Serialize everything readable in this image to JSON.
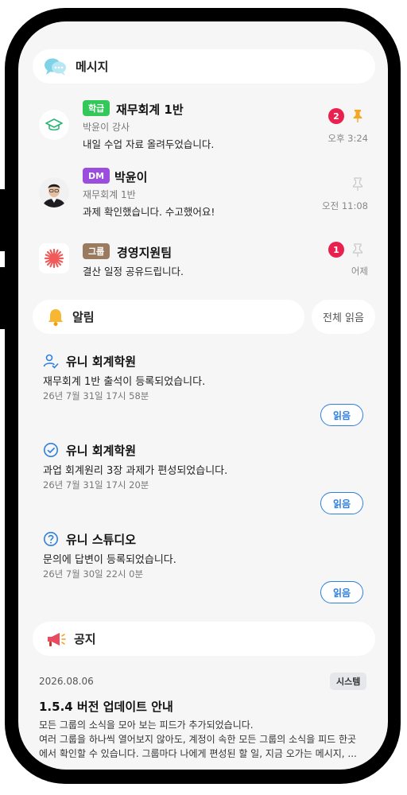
{
  "messages_section": {
    "title": "메시지",
    "icon": "chat-bubbles-icon"
  },
  "messages": [
    {
      "tag": "학급",
      "tag_color": "#34c759",
      "title": "재무회계 1반",
      "subtitle": "박윤이 강사",
      "text": "내일 수업 자료 올려두었습니다.",
      "badge": "2",
      "pinned": true,
      "time": "오후 3:24",
      "avatar": "graduation-cap-icon"
    },
    {
      "tag": "DM",
      "tag_color": "#9b4dde",
      "title": "박윤이",
      "subtitle": "재무회계 1반",
      "text": "과제 확인했습니다. 수고했어요!",
      "badge": "",
      "pinned": false,
      "time": "오전 11:08",
      "avatar": "person-photo"
    },
    {
      "tag": "그룹",
      "tag_color": "#9a7b5f",
      "title": "경영지원팀",
      "subtitle": "",
      "text": "결산 일정 공유드립니다.",
      "badge": "1",
      "pinned": false,
      "time": "어제",
      "avatar": "red-flower-logo"
    }
  ],
  "alerts_section": {
    "title": "알림",
    "icon": "bell-icon",
    "read_all": "전체 읽음"
  },
  "alerts": [
    {
      "icon": "person-check-icon",
      "title": "유니 회계학원",
      "text": "재무회계 1반 출석이 등록되었습니다.",
      "date": "26년 7월 31일 17시 58분",
      "button": "읽음"
    },
    {
      "icon": "circle-check-icon",
      "title": "유니 회계학원",
      "text": "과업 회계원리 3장 과제가 편성되었습니다.",
      "date": "26년 7월 31일 17시 20분",
      "button": "읽음"
    },
    {
      "icon": "question-circle-icon",
      "title": "유니 스튜디오",
      "text": "문의에 답변이 등록되었습니다.",
      "date": "26년 7월 30일 22시 0분",
      "button": "읽음"
    }
  ],
  "notice_section": {
    "title": "공지",
    "icon": "megaphone-icon"
  },
  "notice": {
    "date": "2026.08.06",
    "chip": "시스템",
    "title": "1.5.4 버전 업데이트 안내",
    "body": [
      "모든 그룹의 소식을 모아 보는 피드가 추가되었습니다.",
      "여러 그룹을 하나씩 열어보지 않아도, 계정이 속한 모든 그룹의 소식을 피드 한곳",
      "에서 확인할 수 있습니다. 그룹마다 나에게 편성된 할 일, 지금 오가는 메시지, ..."
    ]
  },
  "colors": {
    "accent": "#2f7fdf",
    "badge": "#e8214f",
    "pin_active": "#f5a623",
    "pin_inactive": "#c8c8c8"
  }
}
